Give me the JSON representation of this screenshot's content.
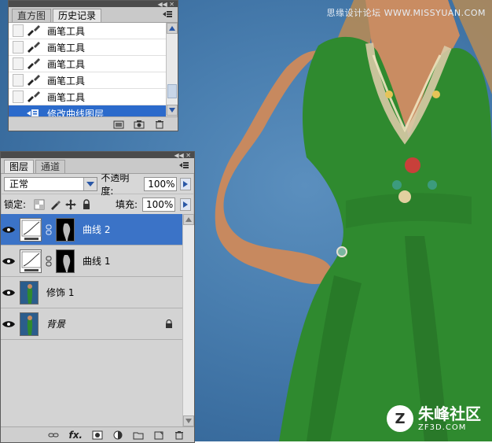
{
  "watermark_text": "思缘设计论坛 WWW.MISSYUAN.COM",
  "brand": {
    "cn": "朱峰社区",
    "en": "ZF3D.COM"
  },
  "history_panel": {
    "tabs": [
      "直方图",
      "历史记录"
    ],
    "active_tab": 1,
    "items": [
      "画笔工具",
      "画笔工具",
      "画笔工具",
      "画笔工具",
      "画笔工具",
      "修改曲线图层"
    ],
    "selected_index": 5
  },
  "layers_panel": {
    "tabs": [
      "图层",
      "通道"
    ],
    "active_tab": 0,
    "blend_mode": "正常",
    "opacity_label": "不透明度:",
    "opacity_value": "100%",
    "lock_label": "锁定:",
    "fill_label": "填充:",
    "fill_value": "100%",
    "layers": [
      {
        "name": "曲线 2",
        "type": "curves",
        "selected": true
      },
      {
        "name": "曲线 1",
        "type": "curves",
        "selected": false
      },
      {
        "name": "修饰 1",
        "type": "image",
        "selected": false
      },
      {
        "name": "背景",
        "type": "background",
        "selected": false,
        "locked": true
      }
    ]
  },
  "colors": {
    "canvas_bg": "#3f77a8",
    "selected_blue": "#2b6acb",
    "dress_green": "#2f8a2f",
    "skin": "#c68b62"
  }
}
